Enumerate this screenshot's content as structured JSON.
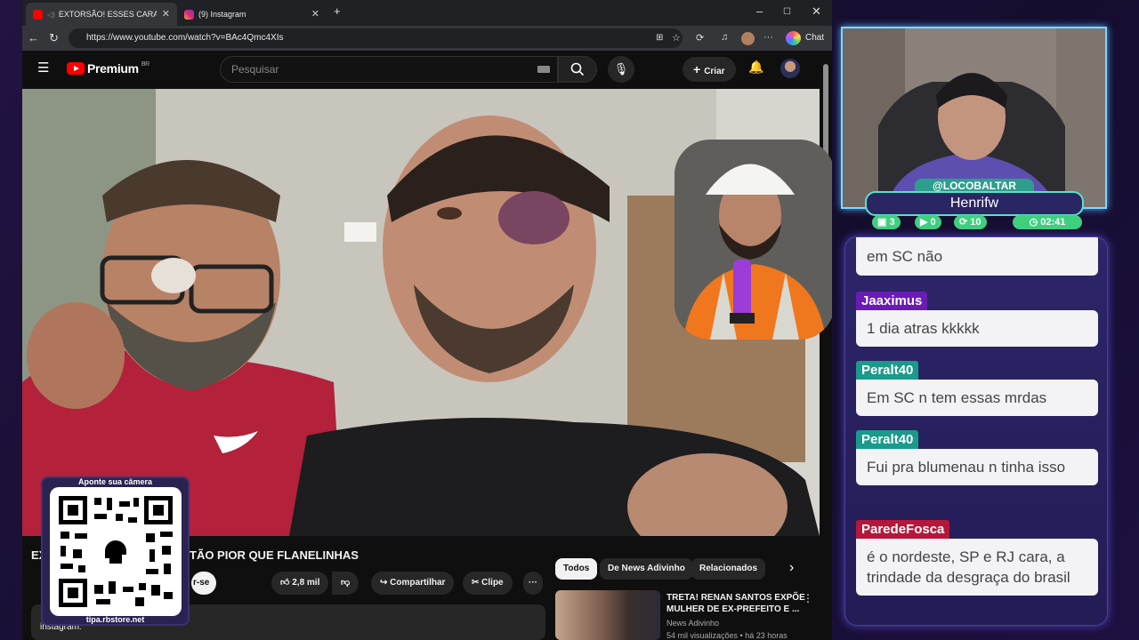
{
  "browser": {
    "tabs": [
      {
        "label": "EXTORSÃO! ESSES CARAS TÃO",
        "active": true,
        "favicon": "youtube-icon"
      },
      {
        "label": "(9) Instagram",
        "active": false,
        "favicon": "instagram-icon"
      }
    ],
    "url": "https://www.youtube.com/watch?v=BAc4Qmc4XIs",
    "chat_button": "Chat"
  },
  "youtube": {
    "logo": "Premium",
    "region": "BR",
    "search_placeholder": "Pesquisar",
    "create_label": "Criar",
    "video_title_left": "EX",
    "video_title_right": "TÃO PIOR QUE FLANELINHAS",
    "subscribe": "r-se",
    "likes": "2,8 mil",
    "share": "Compartilhar",
    "clip": "Clipe",
    "more": "···",
    "description": "instagram:",
    "chips": [
      "Todos",
      "De News Adivinho",
      "Relacionados"
    ],
    "recommendation": {
      "title": "TRETA! RENAN SANTOS EXPÕE MULHER DE EX-PREFEITO E ...",
      "channel": "News Adivinho",
      "views": "54 mil visualizações",
      "age": "há 23 horas"
    }
  },
  "qr": {
    "top": "Aponte sua câmera",
    "bottom": "tipa.rbstore.net"
  },
  "streamer": {
    "handle": "@LOCOBALTAR",
    "name": "Henrifw",
    "stats": [
      {
        "icon": "chat-icon",
        "value": "3"
      },
      {
        "icon": "youtube-icon",
        "value": "0"
      },
      {
        "icon": "refresh-icon",
        "value": "10"
      },
      {
        "icon": "clock-icon",
        "value": "02:41"
      }
    ]
  },
  "chat": {
    "partial": "em SC não",
    "messages": [
      {
        "user": "Jaaximus",
        "text": "1 dia atras kkkkk",
        "color": "#6a1bb5"
      },
      {
        "user": "Peralt40",
        "text": "Em SC n tem essas mrdas",
        "color": "#1a9a8a"
      },
      {
        "user": "Peralt40",
        "text": "Fui pra blumenau n tinha isso",
        "color": "#1a9a8a"
      },
      {
        "user": "ParedeFosca",
        "text": "é o nordeste, SP e RJ cara, a trindade da desgraça do brasil",
        "color": "#b5173a"
      }
    ]
  }
}
